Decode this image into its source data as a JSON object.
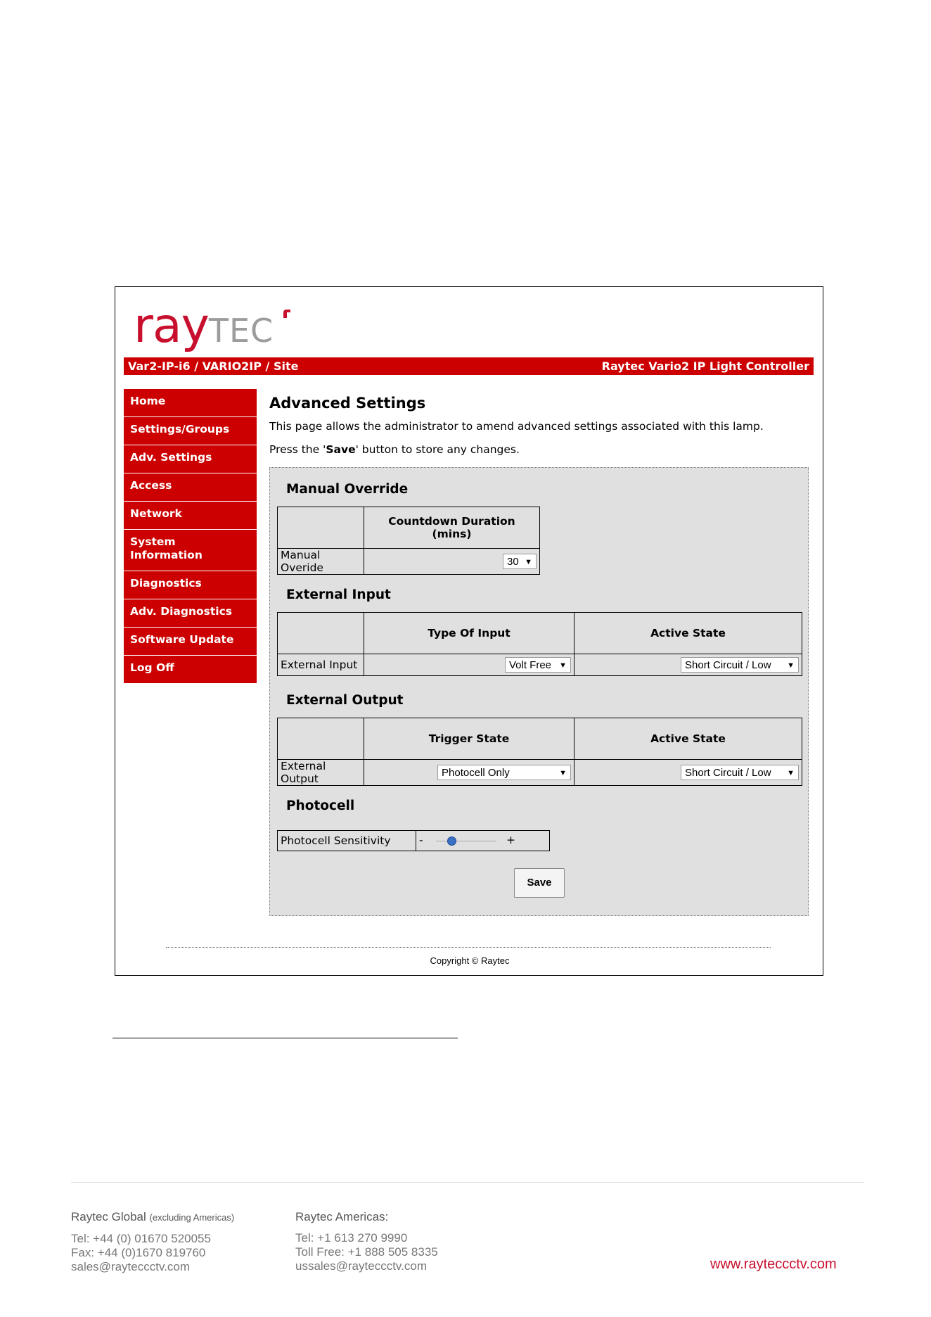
{
  "logo": {
    "part1": "ray",
    "part2": "TEC"
  },
  "topbar": {
    "left": "Var2-IP-i6 / VARIO2IP / Site",
    "right": "Raytec Vario2 IP Light Controller"
  },
  "nav": [
    {
      "label": "Home"
    },
    {
      "label": "Settings/Groups"
    },
    {
      "label": "Adv. Settings"
    },
    {
      "label": "Access"
    },
    {
      "label": "Network"
    },
    {
      "label": "System Information"
    },
    {
      "label": "Diagnostics"
    },
    {
      "label": "Adv. Diagnostics"
    },
    {
      "label": "Software Update"
    },
    {
      "label": "Log Off"
    }
  ],
  "main": {
    "title": "Advanced Settings",
    "intro": "This page allows the administrator to amend advanced settings associated with this lamp.",
    "press_prefix": "Press the '",
    "press_bold": "Save",
    "press_suffix": "' button to store any changes."
  },
  "manual_override": {
    "title": "Manual Override",
    "col_header": "Countdown Duration (mins)",
    "row_label": "Manual Overide",
    "duration_value": "30"
  },
  "external_input": {
    "title": "External Input",
    "col1": "Type Of Input",
    "col2": "Active State",
    "row_label": "External Input",
    "type_value": "Volt Free",
    "state_value": "Short Circuit / Low"
  },
  "external_output": {
    "title": "External Output",
    "col1": "Trigger State",
    "col2": "Active State",
    "row_label": "External Output",
    "trigger_value": "Photocell Only",
    "state_value": "Short Circuit / Low"
  },
  "photocell": {
    "title": "Photocell",
    "label": "Photocell Sensitivity",
    "minus": "-",
    "plus": "+",
    "sensitivity_fraction": 0.25
  },
  "save_label": "Save",
  "copyright": "Copyright © Raytec",
  "footer": {
    "global_head": "Raytec Global",
    "global_note": "(excluding Americas)",
    "global_lines": [
      "Tel: +44 (0) 01670 520055",
      "Fax: +44 (0)1670 819760",
      "sales@rayteccctv.com"
    ],
    "americas_head": "Raytec Americas:",
    "americas_lines": [
      "Tel: +1 613 270 9990",
      "Toll Free: +1 888 505 8335",
      "ussales@rayteccctv.com"
    ],
    "website": "www.rayteccctv.com"
  },
  "colors": {
    "brand_red": "#cc0000",
    "panel_gray": "#e0e0e0",
    "footer_gray": "#777777"
  }
}
